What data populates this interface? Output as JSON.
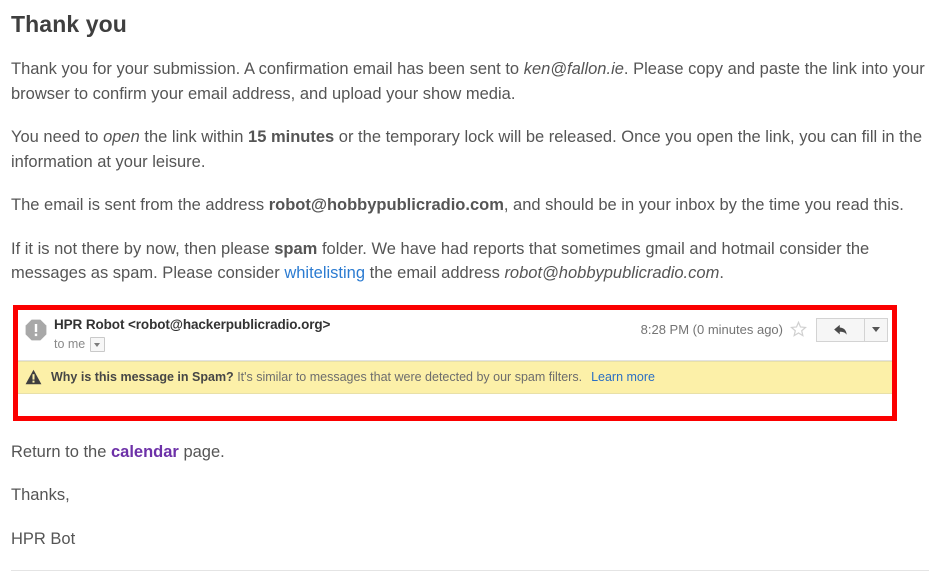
{
  "page": {
    "title": "Thank you"
  },
  "paragraphs": {
    "p1": {
      "part1": "Thank you for your submission. A confirmation email has been sent to ",
      "email_italic": "ken@fallon.ie",
      "part2": ". Please copy and paste the link into your browser to confirm your email address, and upload your show media."
    },
    "p2": {
      "part1": "You need to ",
      "open_italic": "open",
      "part2": " the link within ",
      "minutes_bold": "15 minutes",
      "part3": " or the temporary lock will be released. Once you open the link, you can fill in the information at your leisure."
    },
    "p3": {
      "part1": "The email is sent from the address ",
      "email_bold": "robot@hobbypublicradio.com",
      "part2": ", and should be in your inbox by the time you read this."
    },
    "p4": {
      "part1": "If it is not there by now, then please ",
      "spam_bold": "spam",
      "part2": " folder. We have had reports that sometimes gmail and hotmail consider the messages as spam. Please consider ",
      "whitelisting_link": "whitelisting",
      "part3": " the email address ",
      "email_italic": "robot@hobbypublicradio.com",
      "part4": "."
    },
    "p5": {
      "part1": "Return to the ",
      "calendar_link": "calendar",
      "part2": " page."
    },
    "p6": "Thanks,",
    "p7": "HPR Bot"
  },
  "email_screenshot": {
    "highlight_color": "#fb0000",
    "sender_icon": "exclamation-octagon-icon",
    "sender_name": "HPR Robot ",
    "sender_address": "<robot@hackerpublicradio.org>",
    "recipient_label": "to me",
    "recipient_caret": "chevron-down-icon",
    "timestamp": "8:28 PM (0 minutes ago)",
    "star_icon": "star-outline-icon",
    "reply_icon": "reply-arrow-icon",
    "more_icon": "chevron-down-icon",
    "spam_notice": {
      "icon": "warning-triangle-icon",
      "question": "Why is this message in Spam?",
      "description": "It's similar to messages that were detected by our spam filters.",
      "learn_more_label": "Learn more",
      "background_color": "#fcf0a8",
      "link_color": "#2b6fc4"
    }
  }
}
